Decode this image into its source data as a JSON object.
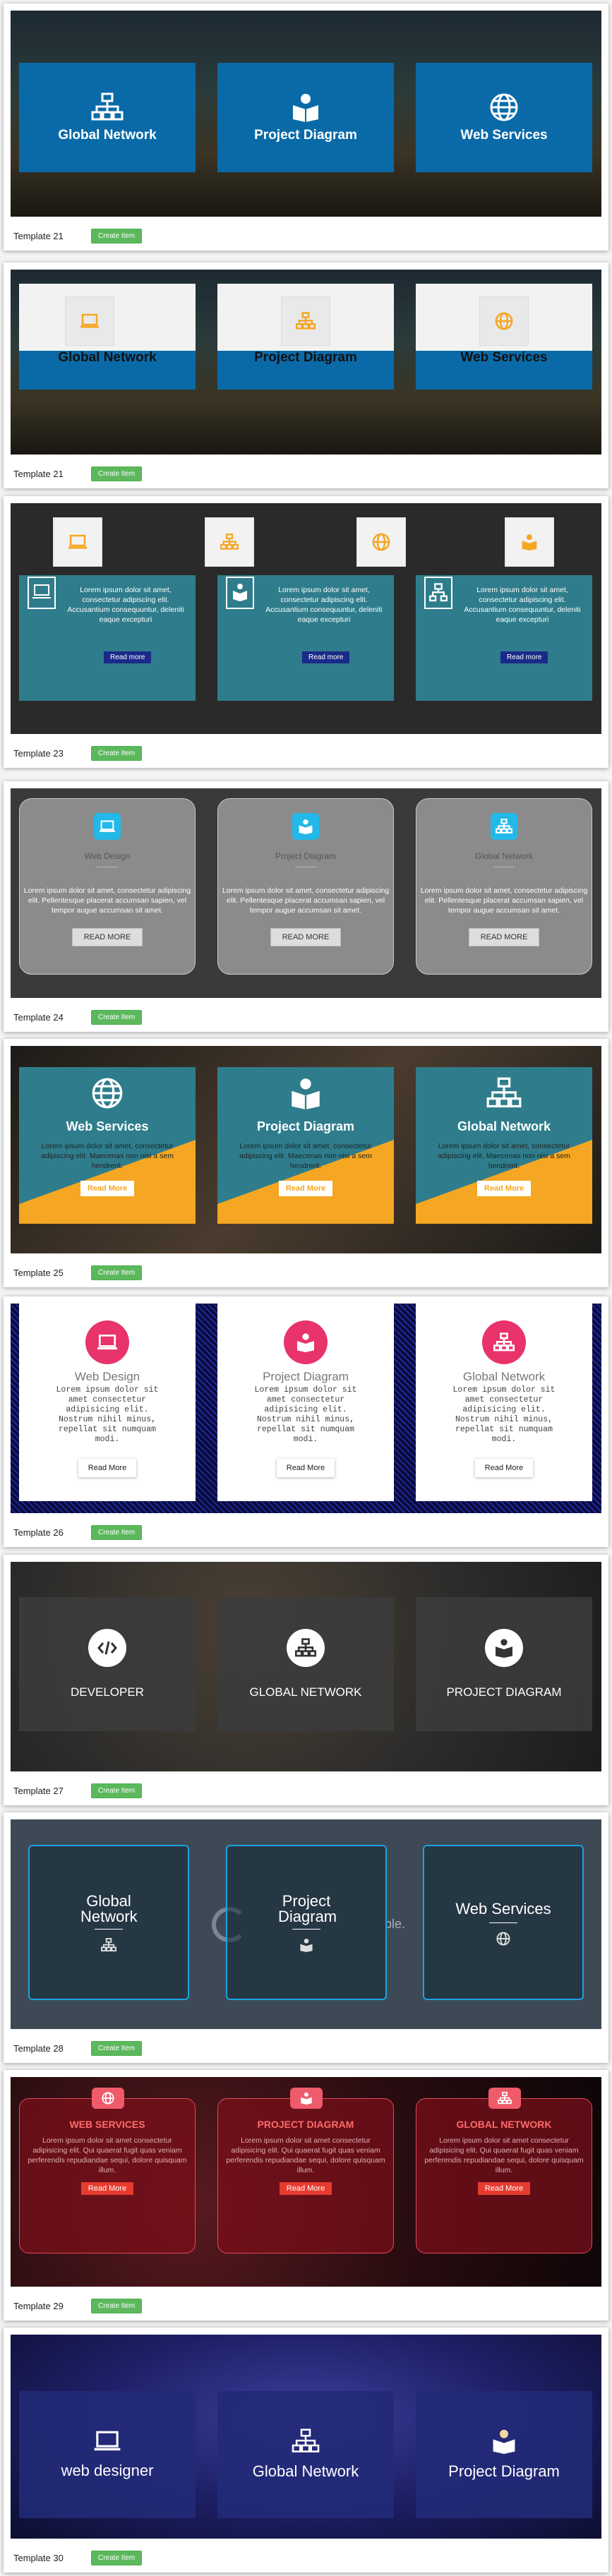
{
  "templates": [
    {
      "name": "Template 21",
      "button": "Create Item",
      "items": [
        "Global Network",
        "Project Diagram",
        "Web Services"
      ]
    },
    {
      "name": "Template 21",
      "button": "Create Item",
      "items": [
        "Global Network",
        "Project Diagram",
        "Web Services"
      ]
    },
    {
      "name": "Template 23",
      "button": "Create Item",
      "body": "Lorem ipsum dolor sit amet, consectetur adipiscing elit. Accusantium consequuntur, deleniti eaque excepturi",
      "cta": "Read more"
    },
    {
      "name": "Template 24",
      "button": "Create Item",
      "items": [
        "Web Design",
        "Project Diagram",
        "Global Network"
      ],
      "body": "Lorem ipsum dolor sit amet, consectetur adipiscing elit. Pellentesque placerat accumsan sapien, vel tempor augue accumsan sit amet.",
      "cta": "READ MORE"
    },
    {
      "name": "Template 25",
      "button": "Create Item",
      "items": [
        "Web Services",
        "Project Diagram",
        "Global Network"
      ],
      "body": "Lorem ipsum dolor sit amet, consectetur adipiscing elit. Maecenas non nisi a sem hendrerit.",
      "cta": "Read More"
    },
    {
      "name": "Template 26",
      "button": "Create Item",
      "items": [
        "Web Design",
        "Project Diagram",
        "Global Network"
      ],
      "body": "Lorem ipsum dolor sit amet consectetur adipisicing elit. Nostrum nihil minus, repellat sit numquam modi.",
      "cta": "Read More"
    },
    {
      "name": "Template 27",
      "button": "Create Item",
      "items": [
        "DEVELOPER",
        "GLOBAL NETWORK",
        "PROJECT DIAGRAM"
      ]
    },
    {
      "name": "Template 28",
      "button": "Create Item",
      "items": [
        "Global Network",
        "Project Diagram",
        "Web Services"
      ],
      "fragment": "ble."
    },
    {
      "name": "Template 29",
      "button": "Create Item",
      "items": [
        "WEB SERVICES",
        "PROJECT DIAGRAM",
        "GLOBAL NETWORK"
      ],
      "body": "Lorem ipsum dolor sit amet consectetur adipisicing elit. Qui quaerat fugit quas veniam perferendis repudiandae sequi, dolore quisquam illum.",
      "cta": "Read More"
    },
    {
      "name": "Template 30",
      "button": "Create Item",
      "items": [
        "web designer",
        "Global Network",
        "Project Diagram"
      ]
    }
  ],
  "colors": {
    "blue": "#0a6aa8",
    "teal": "#2f7d8c",
    "orange": "#f5a623",
    "pink": "#e8336b",
    "green": "#5cb85c",
    "navy": "#222a6e"
  },
  "icons": [
    "sitemap-icon",
    "book-reader-icon",
    "globe-icon",
    "laptop-icon",
    "code-icon"
  ]
}
